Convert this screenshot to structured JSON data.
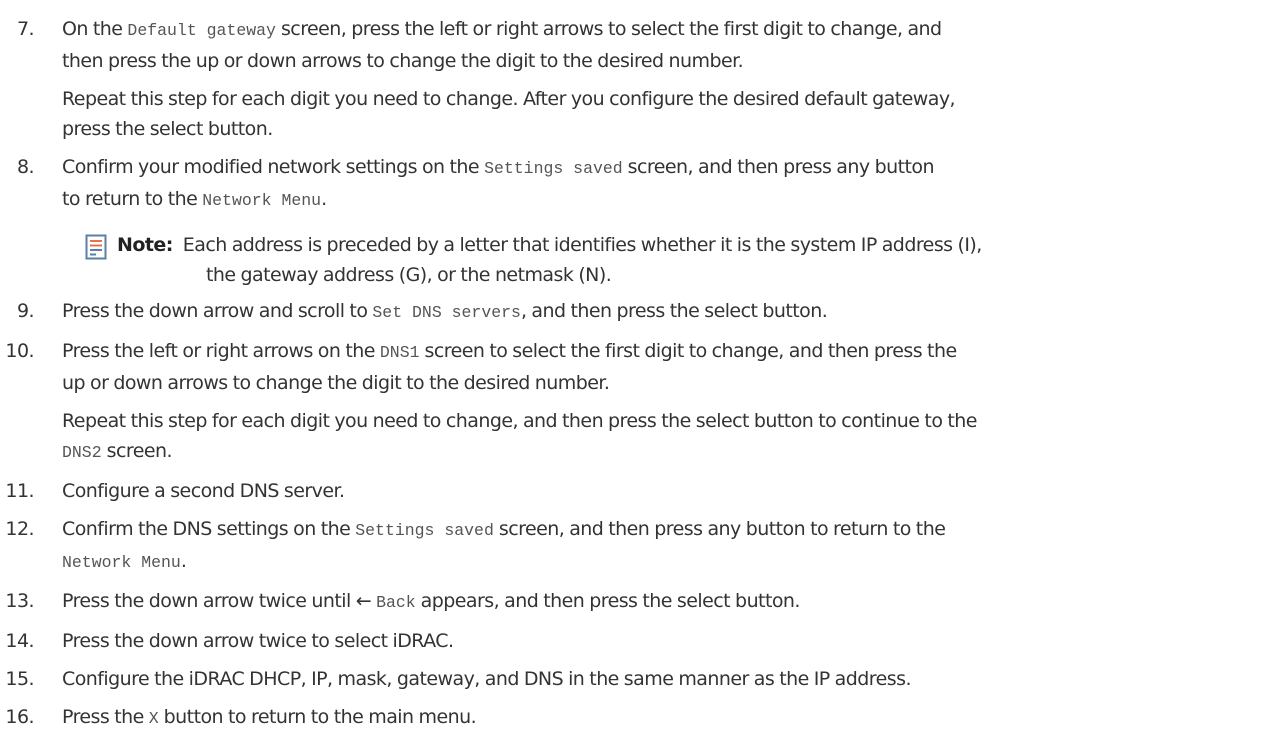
{
  "steps": [
    {
      "number": "7.",
      "line1": [
        "On the ",
        "Default gateway",
        " screen, press the left or right arrows to select the first digit to change, and"
      ],
      "line2": "then press the up or down arrows to change the digit to the desired number.",
      "para1": "Repeat this step for each digit you need to change. After you configure the desired default gateway,",
      "para2": "press the select button."
    },
    {
      "number": "8.",
      "line1": [
        "Confirm your modified network settings on the ",
        "Settings saved",
        " screen, and then press any button"
      ],
      "line2": [
        "to return to the ",
        "Network Menu",
        "."
      ]
    },
    {
      "number": "9.",
      "line1": [
        "Press the down arrow and scroll to ",
        "Set DNS servers",
        ", and then press the select button."
      ]
    },
    {
      "number": "10.",
      "line1": [
        "Press the left or right arrows on the ",
        "DNS1",
        " screen to select the first digit to change, and then press the"
      ],
      "line2": "up or down arrows to change the digit to the desired number.",
      "para1": "Repeat this step for each digit you need to change, and then press the select button to continue to the",
      "para2": [
        "DNS2",
        " screen."
      ]
    },
    {
      "number": "11.",
      "line1": "Configure a second DNS server."
    },
    {
      "number": "12.",
      "line1": [
        "Confirm the DNS settings on the ",
        "Settings saved",
        " screen, and then press any button to return to the"
      ],
      "line2": [
        "Network Menu",
        "."
      ]
    },
    {
      "number": "13.",
      "line1": [
        "Press the down arrow twice until ← ",
        "Back",
        " appears, and then press the select button."
      ]
    },
    {
      "number": "14.",
      "line1": "Press the down arrow twice to select iDRAC."
    },
    {
      "number": "15.",
      "line1": "Configure the iDRAC DHCP, IP, mask, gateway, and DNS in the same manner as the IP address."
    },
    {
      "number": "16.",
      "line1": [
        "Press the ",
        "X",
        " button to return to the main menu."
      ]
    }
  ],
  "note": {
    "label": "Note:",
    "line1": "Each address is preceded by a letter that identifies whether it is the system IP address (I),",
    "line2": "the gateway address (G), or the netmask (N).",
    "icon": "note-icon",
    "icon_accent": "#e8734a",
    "icon_stroke": "#5b7fa6"
  }
}
